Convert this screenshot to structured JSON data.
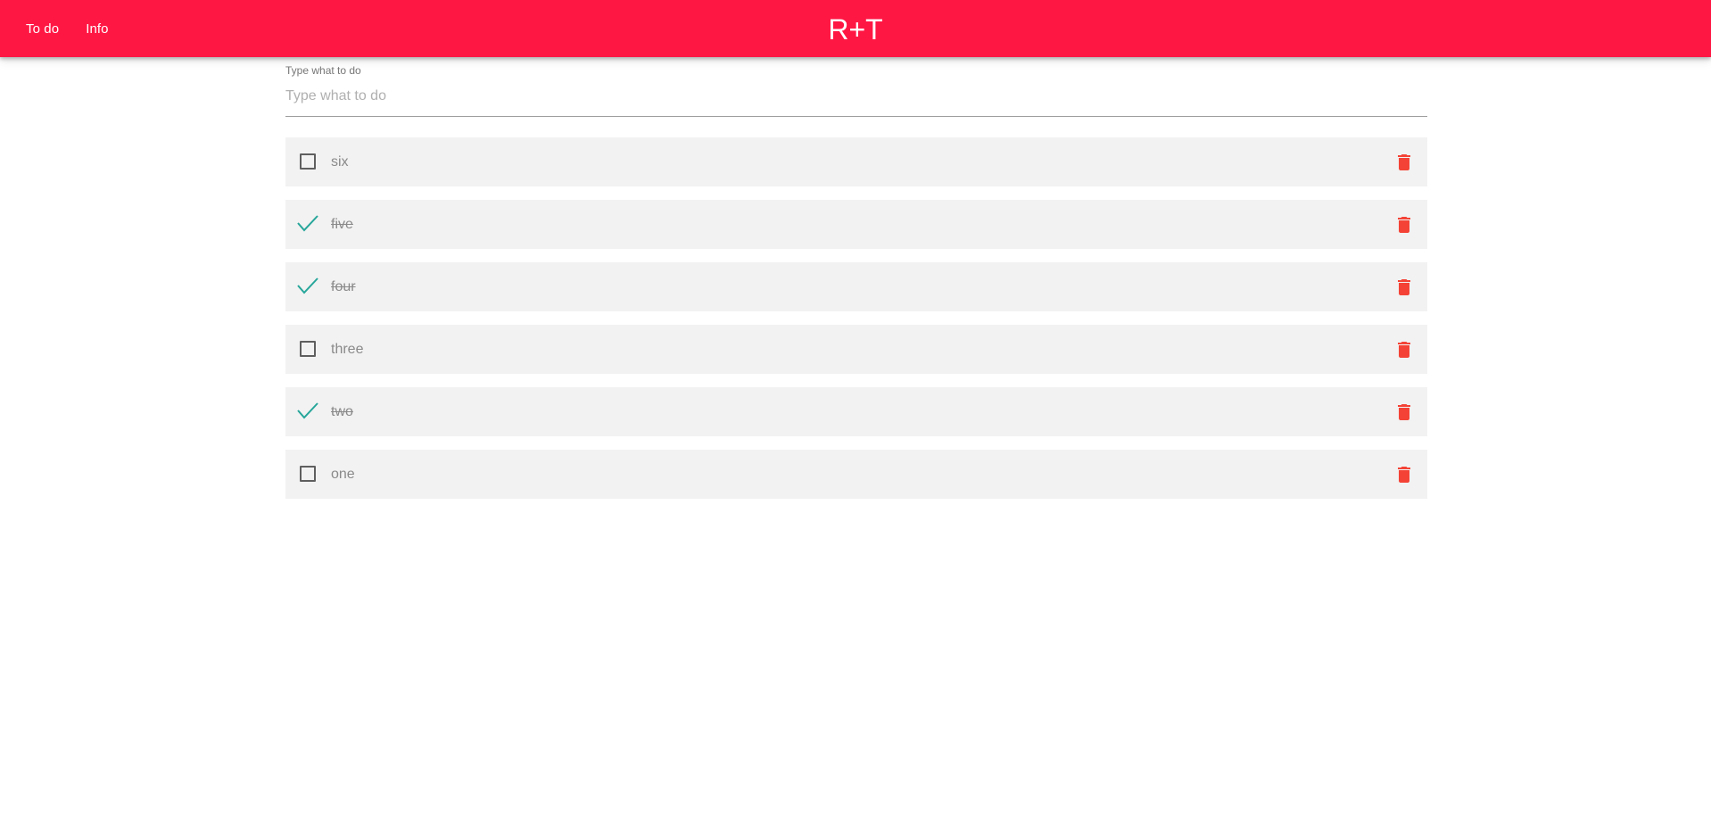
{
  "appbar": {
    "nav": [
      {
        "label": "To do"
      },
      {
        "label": "Info"
      }
    ],
    "title": "R+T",
    "color": "#ff1744"
  },
  "new_todo": {
    "label": "Type what to do",
    "placeholder": "Type what to do",
    "value": ""
  },
  "todos": [
    {
      "text": "six",
      "done": false
    },
    {
      "text": "five",
      "done": true
    },
    {
      "text": "four",
      "done": true
    },
    {
      "text": "three",
      "done": false
    },
    {
      "text": "two",
      "done": true
    },
    {
      "text": "one",
      "done": false
    }
  ],
  "icons": {
    "unchecked": "checkbox-outline-icon",
    "checked": "check-icon",
    "delete": "trash-icon"
  },
  "colors": {
    "check": "#26a69a",
    "delete": "#f44336",
    "item_bg": "#f2f2f2"
  }
}
